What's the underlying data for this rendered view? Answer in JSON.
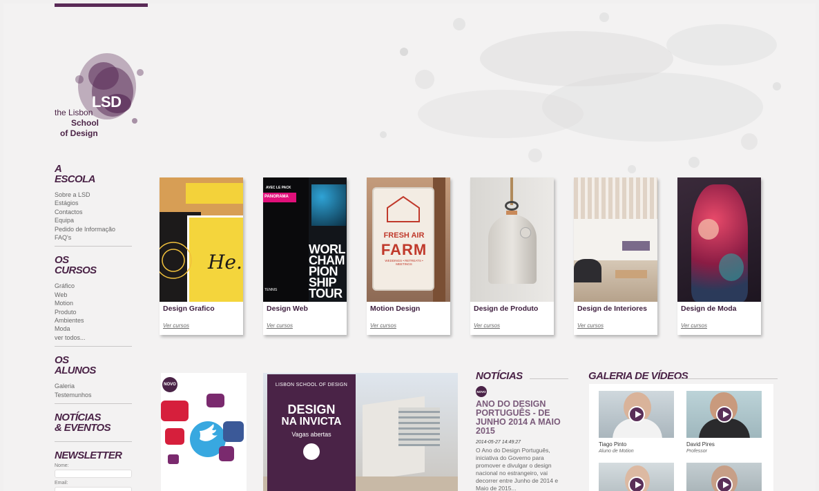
{
  "logo": {
    "mark": "LSD",
    "line1": "the Lisbon",
    "line2": "School",
    "line3": "of Design"
  },
  "sidebar": {
    "escola": {
      "title1": "A",
      "title2": "ESCOLA",
      "links": [
        "Sobre a LSD",
        "Estágios",
        "Contactos",
        "Equipa",
        "Pedido de Informação",
        "FAQ's"
      ]
    },
    "cursos": {
      "title1": "OS",
      "title2": "CURSOS",
      "links": [
        "Gráfico",
        "Web",
        "Motion",
        "Produto",
        "Ambientes",
        "Moda",
        "ver todos..."
      ]
    },
    "alunos": {
      "title1": "OS",
      "title2": "ALUNOS",
      "links": [
        "Galeria",
        "Testemunhos"
      ]
    },
    "noticias": {
      "title1": "NOTÍCIAS",
      "title2": "& EVENTOS"
    },
    "newsletter": {
      "title": "NEWSLETTER",
      "name_label": "Nome:",
      "email_label": "Email:"
    }
  },
  "courses": [
    {
      "title": "Design Grafico",
      "link": "Ver cursos"
    },
    {
      "title": "Design Web",
      "link": "Ver cursos"
    },
    {
      "title": "Motion Design",
      "link": "Ver cursos"
    },
    {
      "title": "Design de Produto",
      "link": "Ver cursos"
    },
    {
      "title": "Design de Interiores",
      "link": "Ver cursos"
    },
    {
      "title": "Design de Moda",
      "link": "Ver cursos"
    }
  ],
  "course_images": {
    "web": {
      "tag1": "AVEC LE PACK",
      "tag2": "PANORAMA",
      "big": "WORLD CHAMPIONSHIP TOUR",
      "small": "TENNIS"
    },
    "motion": {
      "sign1": "FRESH AIR",
      "sign2": "FARM",
      "sign3": "WEDDINGS • RETREATS • MEETINGS"
    }
  },
  "promos": {
    "social_badge": "NOVO",
    "invicta": {
      "top": "LISBON SCHOOL OF DESIGN",
      "title1": "DESIGN",
      "title2": "NA INVICTA",
      "sub": "Vagas abertas"
    }
  },
  "news": {
    "heading": "NOTÍCIAS",
    "badge": "NOVO",
    "title": "ANO DO DESIGN PORTUGUÊS - DE JUNHO 2014 A MAIO 2015",
    "date": "2014-05-27 14:49:27",
    "body": "O Ano do Design Português, iniciativa do Governo para promover e divulgar o design nacional no estrangeiro, vai decorrer entre Junho de 2014 e Maio de 2015..."
  },
  "videos": {
    "heading": "GALERIA DE VÍDEOS",
    "items": [
      {
        "name": "Tiago Pinto",
        "role": "Aluno de Motion"
      },
      {
        "name": "David Pires",
        "role": "Professor"
      }
    ]
  },
  "colors": {
    "brand": "#4a2347",
    "accent": "#e0107a",
    "background": "#f3f2f2"
  }
}
